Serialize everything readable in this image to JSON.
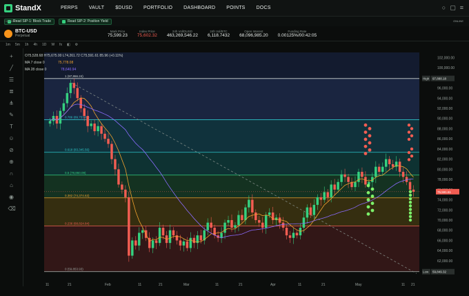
{
  "app": {
    "brand": "StandX"
  },
  "nav": [
    "PERPS",
    "VAULT",
    "$DUSD",
    "PORTFOLIO",
    "DASHBOARD",
    "POINTS",
    "DOCS"
  ],
  "announcements": [
    "Read SIP-1: Block Trade",
    "Read SIP-2: Position Yield"
  ],
  "breadcrumb": "/ MARKET",
  "online": "ONLINE",
  "market": {
    "symbol": "BTC-USD",
    "type": "Perpetual",
    "stats": [
      {
        "k": "Mark Price",
        "v": "75,599.23",
        "red": false
      },
      {
        "k": "Index Price",
        "v": "75,602.32",
        "red": true
      },
      {
        "k": "24h Vol/DUSD",
        "v": "463,269,546.22",
        "red": false
      },
      {
        "k": "24h Vol/BTC",
        "v": "6,118.7432",
        "red": false
      },
      {
        "k": "Open Interest",
        "v": "68,096,985.20",
        "red": false
      },
      {
        "k": "Funding Rate",
        "v": "0.00125%/00:42:05",
        "red": false
      }
    ]
  },
  "toolbar": [
    "1m",
    "5m",
    "1h",
    "4h",
    "1D",
    "W",
    "fx",
    "◧",
    "⚙"
  ],
  "legend": {
    "ohlc": "O75,528.68 H75,675.00 L74,261.72 C75,591.61 85.96 (+0.11%)",
    "ma7": "MA 7 close 0",
    "ma7_val": "75,778.08",
    "ma28": "MA 28 close 0",
    "ma28_val": "78,640.94"
  },
  "chart_data": {
    "type": "candlestick",
    "x_ticks": [
      "11",
      "21",
      "Feb",
      "11",
      "21",
      "Mar",
      "11",
      "21",
      "Apr",
      "11",
      "21",
      "May",
      "11",
      "21"
    ],
    "y_ticks": [
      "102,000.00",
      "100,000.00",
      "98,000.00",
      "96,000.00",
      "94,000.00",
      "92,000.00",
      "90,000.00",
      "88,000.00",
      "86,000.00",
      "84,000.00",
      "82,000.00",
      "80,000.00",
      "78,000.00",
      "76,000.00",
      "74,000.00",
      "72,000.00",
      "70,000.00",
      "68,000.00",
      "66,000.00",
      "64,000.00",
      "62,000.00",
      "60,000.00"
    ],
    "ylim": [
      59000,
      103000
    ],
    "fib_levels": [
      {
        "label": "1 (97,866.24)",
        "value": 97866.24,
        "color": "#cfd6d2"
      },
      {
        "label": "0.786 (89,753.61)",
        "value": 89753.61,
        "color": "#2ec7c9"
      },
      {
        "label": "0.618 (83,345.56)",
        "value": 83345.56,
        "color": "#2ec7c9"
      },
      {
        "label": "0.5 (78,860.09)",
        "value": 78860.09,
        "color": "#35d07f"
      },
      {
        "label": "0.382 (74,374.63)",
        "value": 74374.63,
        "color": "#f0a12e"
      },
      {
        "label": "0.236 (68,824.84)",
        "value": 68824.84,
        "color": "#f25d52"
      },
      {
        "label": "0 (59,853.93)",
        "value": 59853.93,
        "color": "#9aa39f"
      }
    ],
    "high_label": {
      "tag": "High",
      "value": "97,888.18"
    },
    "low_label": {
      "tag": "Low",
      "value": "59,849.32"
    },
    "last_price": "75,591.61",
    "closes": [
      89500,
      90500,
      89000,
      91500,
      93000,
      95000,
      97000,
      96000,
      94000,
      92000,
      90500,
      88500,
      89000,
      87500,
      88500,
      87000,
      86000,
      85000,
      82000,
      80000,
      77000,
      76000,
      74500,
      63000,
      66000,
      65000,
      67500,
      68000,
      66500,
      64500,
      66000,
      65500,
      68500,
      67000,
      65500,
      68000,
      67000,
      66000,
      65000,
      65800,
      64500,
      66500,
      65500,
      67000,
      66000,
      68000,
      69500,
      68500,
      67000,
      66500,
      67500,
      69500,
      70000,
      68500,
      69000,
      71000,
      70000,
      72500,
      74000,
      71500,
      70000,
      69500,
      68500,
      71000,
      71500,
      70000,
      70500,
      69500,
      68500,
      67000,
      66500,
      67500,
      67000,
      68500,
      70500,
      72500,
      71000,
      73000,
      74500,
      74000,
      75500,
      74500,
      77000,
      76000,
      77500,
      79000,
      78500,
      77500,
      76500,
      77500,
      79500,
      78500,
      77000,
      77500,
      78500,
      80500,
      79500,
      80500,
      82000,
      81000,
      80500,
      81500,
      79500,
      78500,
      77500,
      76000,
      75591
    ],
    "sell_dots": [
      88700,
      88000,
      87300,
      86600,
      85900,
      85200,
      84500,
      83800,
      83100
    ],
    "buy_dots": [
      76800,
      76100,
      75400,
      74700,
      74000,
      73300,
      72600,
      71900,
      71200
    ]
  }
}
